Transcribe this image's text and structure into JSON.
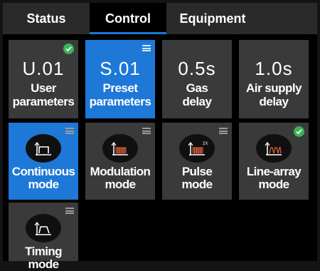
{
  "tabs": [
    "Status",
    "Control",
    "Equipment"
  ],
  "active_tab": "Control",
  "parameters": [
    {
      "value": "U.01",
      "label": "User\nparameters",
      "selected": false,
      "badge": "check-icon"
    },
    {
      "value": "S.01",
      "label": "Preset\nparameters",
      "selected": true,
      "badge": "menu-icon"
    },
    {
      "value": "0.5s",
      "label": "Gas\ndelay",
      "selected": false,
      "badge": ""
    },
    {
      "value": "1.0s",
      "label": "Air supply\ndelay",
      "selected": false,
      "badge": ""
    }
  ],
  "modes": [
    {
      "label": "Continuous\nmode",
      "icon": "continuous-wave-icon",
      "selected": true,
      "badge": "menu-icon"
    },
    {
      "label": "Modulation\nmode",
      "icon": "modulation-wave-icon",
      "selected": false,
      "badge": "menu-icon"
    },
    {
      "label": "Pulse\nmode",
      "icon": "pulse-wave-icon",
      "icon_text": "2X",
      "selected": false,
      "badge": "menu-icon"
    },
    {
      "label": "Line-array\nmode",
      "icon": "line-array-wave-icon",
      "selected": false,
      "badge": "check-icon"
    },
    {
      "label": "Timing\nmode",
      "icon": "timing-wave-icon",
      "selected": false,
      "badge": "menu-icon"
    }
  ],
  "colors": {
    "accent": "#1e78d7",
    "tile": "#3a3a3a",
    "check": "#3cb35a",
    "icon_red": "#e0603a"
  }
}
